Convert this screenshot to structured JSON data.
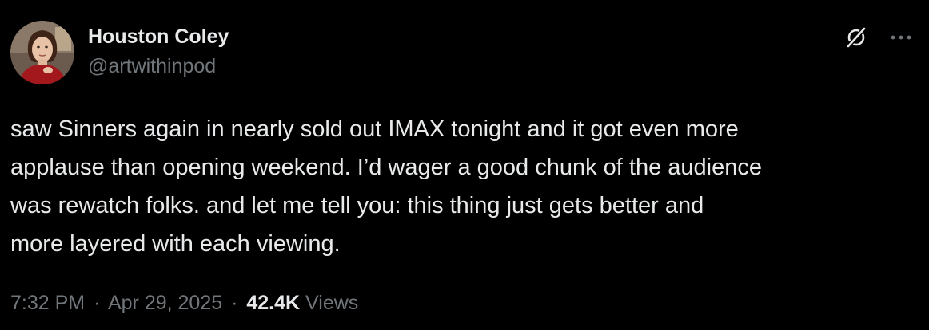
{
  "author": {
    "display_name": "Houston Coley",
    "handle": "@artwithinpod",
    "avatar_icon": "profile-photo"
  },
  "header_actions": {
    "grok_icon": "grok-icon",
    "more_icon": "more-icon"
  },
  "tweet": {
    "lines": [
      "saw Sinners again in nearly sold out IMAX tonight and it got even more",
      "applause than opening weekend. I’d wager a good chunk of the audience",
      "was rewatch folks. and let me tell you: this thing just gets better and",
      "more layered with each viewing."
    ]
  },
  "meta": {
    "time": "7:32 PM",
    "separator": "·",
    "date": "Apr 29, 2025",
    "views_count": "42.4K",
    "views_label": "Views"
  },
  "colors": {
    "background": "#000000",
    "primary_text": "#e7e9ea",
    "secondary_text": "#71767b"
  }
}
